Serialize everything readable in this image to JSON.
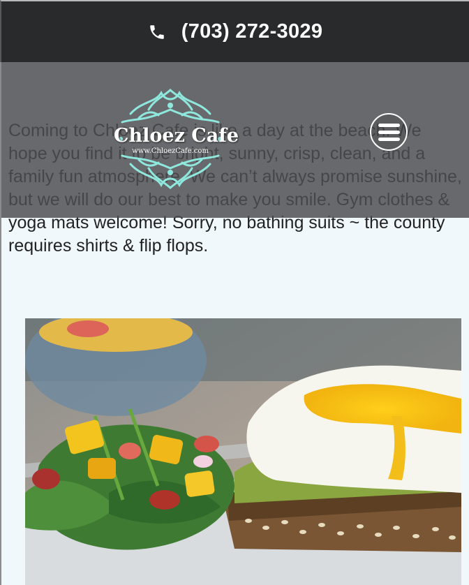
{
  "topbar": {
    "phone": "(703) 272-3029",
    "icon": "phone-icon"
  },
  "header": {
    "logo_title": "Chloez Cafe",
    "logo_url": "www.ChloezCafe.com",
    "menu_icon": "hamburger-menu-icon"
  },
  "main": {
    "intro": "Coming to Chloez Cafe is like a day at the beach. We hope you find it to be bright, sunny, crisp, clean, and a family fun atmosphere. We can’t always promise sunshine, but we will do our best to make you smile. Gym clothes & yoga mats welcome! Sorry, no bathing suits ~ the county requires shirts & flip flops."
  },
  "colors": {
    "topbar": "#282a2b",
    "header_overlay": "#4e4e50",
    "logo_accent": "#8fe8de",
    "page_background": "#f1f8fc"
  }
}
